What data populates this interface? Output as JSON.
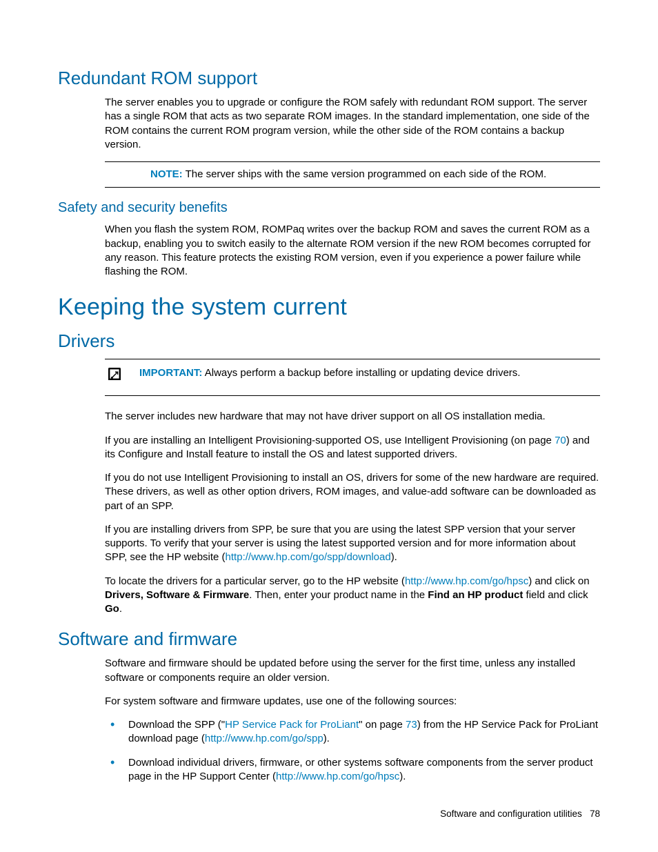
{
  "sections": {
    "redundant_rom": {
      "title": "Redundant ROM support",
      "p1": "The server enables you to upgrade or configure the ROM safely with redundant ROM support. The server has a single ROM that acts as two separate ROM images. In the standard implementation, one side of the ROM contains the current ROM program version, while the other side of the ROM contains a backup version.",
      "note_label": "NOTE:",
      "note_text": "  The server ships with the same version programmed on each side of the ROM.",
      "safety": {
        "title": "Safety and security benefits",
        "p1": "When you flash the system ROM, ROMPaq writes over the backup ROM and saves the current ROM as a backup, enabling you to switch easily to the alternate ROM version if the new ROM becomes corrupted for any reason. This feature protects the existing ROM version, even if you experience a power failure while flashing the ROM."
      }
    },
    "keeping_current": {
      "title": "Keeping the system current"
    },
    "drivers": {
      "title": "Drivers",
      "important_label": "IMPORTANT:",
      "important_text": "  Always perform a backup before installing or updating device drivers.",
      "p1": "The server includes new hardware that may not have driver support on all OS installation media.",
      "p2_a": "If you are installing an Intelligent Provisioning-supported OS, use Intelligent Provisioning (on page ",
      "p2_link": "70",
      "p2_b": ") and its Configure and Install feature to install the OS and latest supported drivers.",
      "p3": "If you do not use Intelligent Provisioning to install an OS, drivers for some of the new hardware are required. These drivers, as well as other option drivers, ROM images, and value-add software can be downloaded as part of an SPP.",
      "p4_a": "If you are installing drivers from SPP, be sure that you are using the latest SPP version that your server supports. To verify that your server is using the latest supported version and for more information about SPP, see the HP website (",
      "p4_link": "http://www.hp.com/go/spp/download",
      "p4_b": ").",
      "p5_a": "To locate the drivers for a particular server, go to the HP website (",
      "p5_link": "http://www.hp.com/go/hpsc",
      "p5_b": ") and click on ",
      "p5_bold1": "Drivers, Software & Firmware",
      "p5_c": ". Then, enter your product name in the ",
      "p5_bold2": "Find an HP product",
      "p5_d": " field and click ",
      "p5_bold3": "Go",
      "p5_e": "."
    },
    "software_firmware": {
      "title": "Software and firmware",
      "p1": "Software and firmware should be updated before using the server for the first time, unless any installed software or components require an older version.",
      "p2": "For system software and firmware updates, use one of the following sources:",
      "bullets": [
        {
          "a": "Download the SPP (\"",
          "link1": "HP Service Pack for ProLiant",
          "b": "\" on page ",
          "link2": "73",
          "c": ") from the HP Service Pack for ProLiant download page (",
          "link3": "http://www.hp.com/go/spp",
          "d": ")."
        },
        {
          "a": "Download individual drivers, firmware, or other systems software components from the server product page in the HP Support Center (",
          "link1": "http://www.hp.com/go/hpsc",
          "b": ")."
        }
      ]
    }
  },
  "footer": {
    "text": "Software and configuration utilities",
    "page": "78"
  }
}
